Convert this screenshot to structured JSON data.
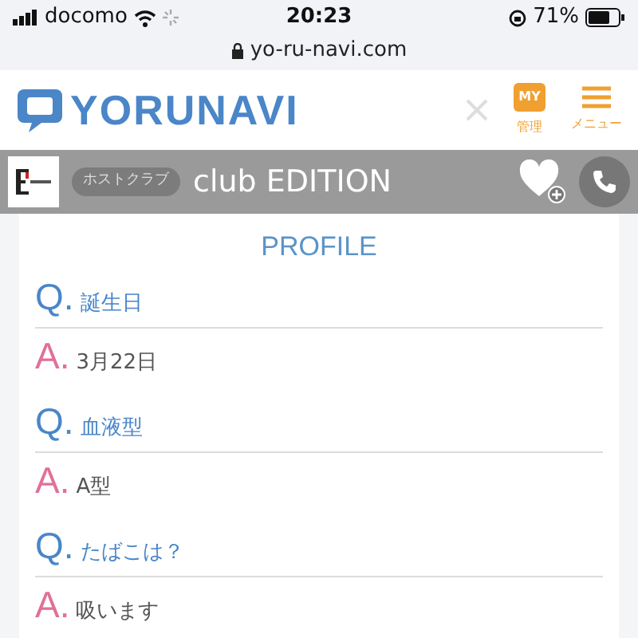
{
  "status_bar": {
    "carrier": "docomo",
    "time": "20:23",
    "battery": "71%",
    "url": "yo-ru-navi.com"
  },
  "header": {
    "logo": "YORUNAVI",
    "my_badge": "MY",
    "my_label": "管理",
    "menu_label": "メニュー"
  },
  "shop_bar": {
    "category": "ホストクラブ",
    "name": "club EDITION"
  },
  "profile": {
    "title": "PROFILE",
    "items": [
      {
        "q_mark": "Q.",
        "question": "誕生日",
        "a_mark": "A.",
        "answer": "3月22日"
      },
      {
        "q_mark": "Q.",
        "question": "血液型",
        "a_mark": "A.",
        "answer": "A型"
      },
      {
        "q_mark": "Q.",
        "question": "たばこは？",
        "a_mark": "A.",
        "answer": "吸います"
      }
    ]
  }
}
